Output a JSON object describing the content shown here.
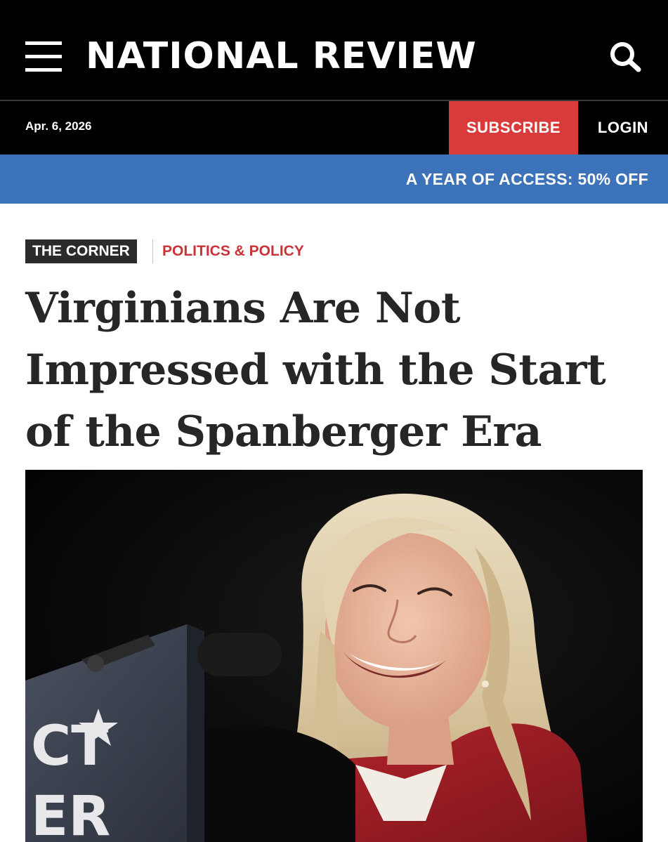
{
  "masthead": {
    "brand": "NATIONAL REVIEW",
    "menu_icon": "hamburger-menu-icon",
    "search_icon": "search-icon"
  },
  "subbar": {
    "date": "Apr. 6, 2026",
    "subscribe_label": "SUBSCRIBE",
    "login_label": "LOGIN"
  },
  "promo": {
    "text": "A YEAR OF ACCESS: 50% OFF"
  },
  "article": {
    "kicker": "THE CORNER",
    "section": "POLITICS & POLICY",
    "headline": "Virginians Are Not Impressed with the Start of the Spanberger Era",
    "image": {
      "podium_text": "CT",
      "podium_text_bottom": "ER"
    }
  },
  "colors": {
    "subscribe_bg": "#d93a3a",
    "promo_bg": "#3c72b9",
    "section_red": "#c8343a",
    "kicker_bg": "#2b2b2b"
  }
}
